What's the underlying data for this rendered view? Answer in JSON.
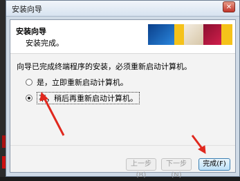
{
  "window": {
    "title": "安装向导",
    "close_symbol": "✕"
  },
  "header": {
    "title": "安装向导",
    "subtitle": "安装完成。"
  },
  "content": {
    "message": "向导已完成终端程序的安装，必须重新启动计算机。",
    "option_restart_now": "是，立即重新启动计算机。",
    "option_restart_later": "不，稍后再重新启动计算机。",
    "selected_option": "option_restart_later"
  },
  "buttons": {
    "back": "上一步(B)",
    "next": "下一步(N)",
    "finish": "完成(F)"
  },
  "colors": {
    "annotation_arrow": "#e0281e",
    "logo_blue": "#1f6fc4",
    "logo_yellow": "#f5c21a",
    "logo_red": "#c0143c"
  },
  "icons": [
    "close-icon",
    "logo-graphic",
    "red-arrow-annotation"
  ]
}
